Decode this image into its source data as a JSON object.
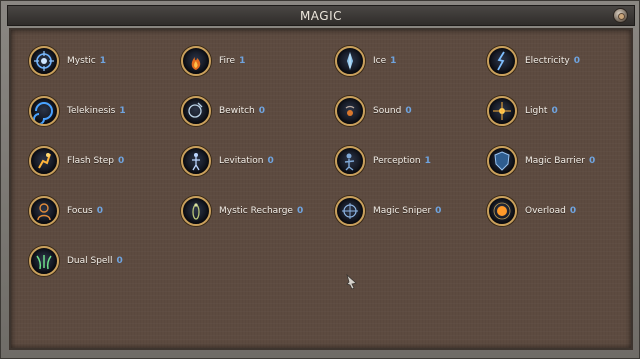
{
  "window": {
    "title": "MAGIC"
  },
  "colors": {
    "level": "#6fa4e0",
    "frame": "#c9a05c",
    "panel": "#5d4b40"
  },
  "skills": [
    {
      "name": "Mystic",
      "level": "1",
      "icon": "mystic-icon"
    },
    {
      "name": "Fire",
      "level": "1",
      "icon": "fire-icon"
    },
    {
      "name": "Ice",
      "level": "1",
      "icon": "ice-icon"
    },
    {
      "name": "Electricity",
      "level": "0",
      "icon": "electricity-icon"
    },
    {
      "name": "Telekinesis",
      "level": "1",
      "icon": "telekinesis-icon"
    },
    {
      "name": "Bewitch",
      "level": "0",
      "icon": "bewitch-icon"
    },
    {
      "name": "Sound",
      "level": "0",
      "icon": "sound-icon"
    },
    {
      "name": "Light",
      "level": "0",
      "icon": "light-icon"
    },
    {
      "name": "Flash Step",
      "level": "0",
      "icon": "flash-step-icon"
    },
    {
      "name": "Levitation",
      "level": "0",
      "icon": "levitation-icon"
    },
    {
      "name": "Perception",
      "level": "1",
      "icon": "perception-icon"
    },
    {
      "name": "Magic Barrier",
      "level": "0",
      "icon": "magic-barrier-icon"
    },
    {
      "name": "Focus",
      "level": "0",
      "icon": "focus-icon"
    },
    {
      "name": "Mystic Recharge",
      "level": "0",
      "icon": "mystic-recharge-icon"
    },
    {
      "name": "Magic Sniper",
      "level": "0",
      "icon": "magic-sniper-icon"
    },
    {
      "name": "Overload",
      "level": "0",
      "icon": "overload-icon"
    },
    {
      "name": "Dual Spell",
      "level": "0",
      "icon": "dual-spell-icon"
    }
  ]
}
